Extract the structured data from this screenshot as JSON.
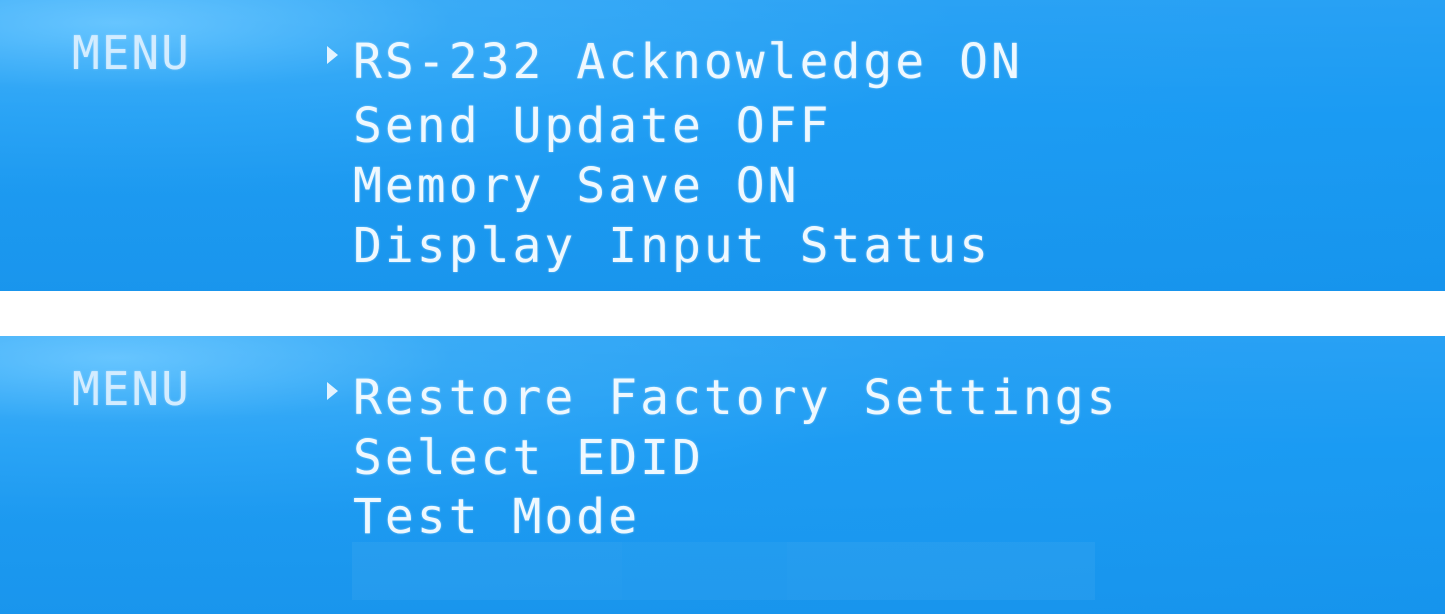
{
  "screens": [
    {
      "title": "MENU",
      "cursor_glyph": "▸",
      "selected_index": 0,
      "items": [
        {
          "label": "RS-232 Acknowledge ON"
        },
        {
          "label": "Send Update OFF"
        },
        {
          "label": "Memory Save ON"
        },
        {
          "label": "Display Input Status"
        }
      ]
    },
    {
      "title": "MENU",
      "cursor_glyph": "▸",
      "selected_index": 0,
      "items": [
        {
          "label": "Restore Factory Settings"
        },
        {
          "label": "Select EDID"
        },
        {
          "label": "Test Mode"
        }
      ]
    }
  ],
  "colors": {
    "lcd_background": "#1d9cf3",
    "text": "#eef8ff",
    "menu_label": "#d3ecff"
  }
}
